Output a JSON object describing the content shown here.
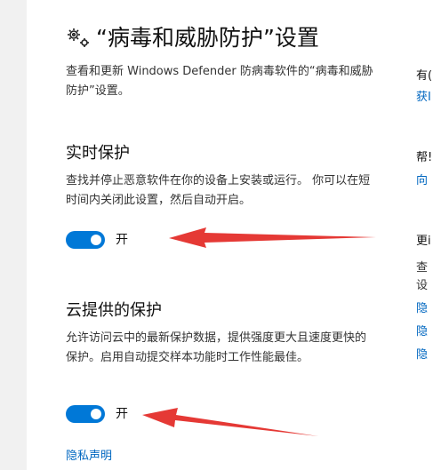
{
  "page": {
    "title": "“病毒和威胁防护”设置",
    "description": "查看和更新 Windows Defender 防病毒软件的“病毒和威胁防护”设置。"
  },
  "realtime": {
    "heading": "实时保护",
    "description": "查找并停止恶意软件在你的设备上安装或运行。 你可以在短时间内关闭此设置，然后自动开启。",
    "toggle_state": "开"
  },
  "cloud": {
    "heading": "云提供的保护",
    "description": "允许访问云中的最新保护数据，提供强度更大且速度更快的保护。启用自动提交样本功能时工作性能最佳。",
    "toggle_state": "开"
  },
  "privacy_link": "隐私声明",
  "sidebar": {
    "s1_title": "有(",
    "s1_link": "获I",
    "s2_title": "帮!",
    "s2_link": "向",
    "s3_title": "更i",
    "s3_text1": "查",
    "s3_text2": "设",
    "s3_link1": "隐",
    "s3_link2": "隐",
    "s3_link3": "隐"
  },
  "colors": {
    "accent": "#0078d7",
    "link": "#0067c0",
    "annotation_arrow": "#e53935"
  }
}
